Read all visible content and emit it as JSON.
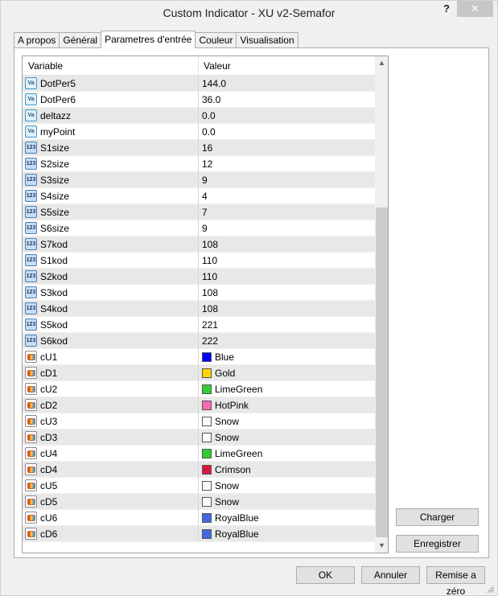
{
  "window": {
    "title": "Custom Indicator - XU v2-Semafor",
    "help_label": "?",
    "close_label": "✕"
  },
  "tabs": [
    {
      "label": "A propos"
    },
    {
      "label": "Général"
    },
    {
      "label": "Parametres d'entrée",
      "active": true
    },
    {
      "label": "Couleur"
    },
    {
      "label": "Visualisation"
    }
  ],
  "grid": {
    "headers": {
      "variable": "Variable",
      "value": "Valeur"
    },
    "rows": [
      {
        "icon": "Va",
        "name": "DotPer5",
        "value": "144.0"
      },
      {
        "icon": "Va",
        "name": "DotPer6",
        "value": "36.0"
      },
      {
        "icon": "Va",
        "name": "deltazz",
        "value": "0.0"
      },
      {
        "icon": "Va",
        "name": "myPoint",
        "value": "0.0"
      },
      {
        "icon": "123",
        "name": "S1size",
        "value": "16"
      },
      {
        "icon": "123",
        "name": "S2size",
        "value": "12"
      },
      {
        "icon": "123",
        "name": "S3size",
        "value": "9"
      },
      {
        "icon": "123",
        "name": "S4size",
        "value": "4"
      },
      {
        "icon": "123",
        "name": "S5size",
        "value": "7"
      },
      {
        "icon": "123",
        "name": "S6size",
        "value": "9"
      },
      {
        "icon": "123",
        "name": "S7kod",
        "value": "108"
      },
      {
        "icon": "123",
        "name": "S1kod",
        "value": "110"
      },
      {
        "icon": "123",
        "name": "S2kod",
        "value": "110"
      },
      {
        "icon": "123",
        "name": "S3kod",
        "value": "108"
      },
      {
        "icon": "123",
        "name": "S4kod",
        "value": "108"
      },
      {
        "icon": "123",
        "name": "S5kod",
        "value": "221"
      },
      {
        "icon": "123",
        "name": "S6kod",
        "value": "222"
      },
      {
        "icon": "color",
        "name": "cU1",
        "value": "Blue",
        "color": "#0000ff"
      },
      {
        "icon": "color",
        "name": "cD1",
        "value": "Gold",
        "color": "#ffd700"
      },
      {
        "icon": "color",
        "name": "cU2",
        "value": "LimeGreen",
        "color": "#32cd32"
      },
      {
        "icon": "color",
        "name": "cD2",
        "value": "HotPink",
        "color": "#ff69b4"
      },
      {
        "icon": "color",
        "name": "cU3",
        "value": "Snow",
        "color": "#fffafa"
      },
      {
        "icon": "color",
        "name": "cD3",
        "value": "Snow",
        "color": "#fffafa"
      },
      {
        "icon": "color",
        "name": "cU4",
        "value": "LimeGreen",
        "color": "#32cd32"
      },
      {
        "icon": "color",
        "name": "cD4",
        "value": "Crimson",
        "color": "#dc143c"
      },
      {
        "icon": "color",
        "name": "cU5",
        "value": "Snow",
        "color": "#fffafa"
      },
      {
        "icon": "color",
        "name": "cD5",
        "value": "Snow",
        "color": "#fffafa"
      },
      {
        "icon": "color",
        "name": "cU6",
        "value": "RoyalBlue",
        "color": "#4169e1"
      },
      {
        "icon": "color",
        "name": "cD6",
        "value": "RoyalBlue",
        "color": "#4169e1"
      }
    ]
  },
  "buttons": {
    "charger": "Charger",
    "enregistrer": "Enregistrer",
    "ok": "OK",
    "annuler": "Annuler",
    "reset": "Remise a zéro"
  }
}
